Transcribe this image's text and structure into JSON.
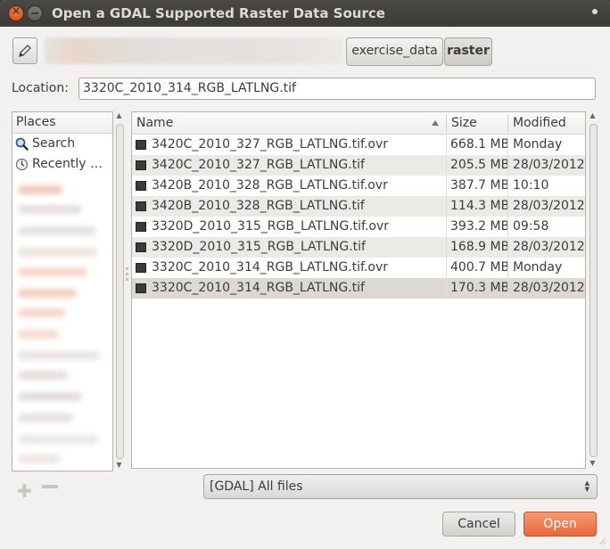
{
  "window": {
    "title": "Open a GDAL Supported Raster Data Source"
  },
  "path_bar": {
    "crumbs": [
      "exercise_data",
      "raster"
    ],
    "active_crumb": "raster"
  },
  "location": {
    "label": "Location:",
    "value": "3320C_2010_314_RGB_LATLNG.tif"
  },
  "places": {
    "header": "Places",
    "items": [
      {
        "label": "Search",
        "icon": "search-icon"
      },
      {
        "label": "Recently …",
        "icon": "recent-clock-icon"
      }
    ]
  },
  "files": {
    "columns": {
      "name": "Name",
      "size": "Size",
      "modified": "Modified"
    },
    "sort": "name-ascending",
    "rows": [
      {
        "name": "3420C_2010_327_RGB_LATLNG.tif.ovr",
        "size": "668.1 MB",
        "modified": "Monday"
      },
      {
        "name": "3420C_2010_327_RGB_LATLNG.tif",
        "size": "205.5 MB",
        "modified": "28/03/2012"
      },
      {
        "name": "3420B_2010_328_RGB_LATLNG.tif.ovr",
        "size": "387.7 MB",
        "modified": "10:10"
      },
      {
        "name": "3420B_2010_328_RGB_LATLNG.tif",
        "size": "114.3 MB",
        "modified": "28/03/2012"
      },
      {
        "name": "3320D_2010_315_RGB_LATLNG.tif.ovr",
        "size": "393.2 MB",
        "modified": "09:58"
      },
      {
        "name": "3320D_2010_315_RGB_LATLNG.tif",
        "size": "168.9 MB",
        "modified": "28/03/2012"
      },
      {
        "name": "3320C_2010_314_RGB_LATLNG.tif.ovr",
        "size": "400.7 MB",
        "modified": "Monday"
      },
      {
        "name": "3320C_2010_314_RGB_LATLNG.tif",
        "size": "170.3 MB",
        "modified": "28/03/2012"
      }
    ]
  },
  "filter": {
    "selected": "[GDAL] All files"
  },
  "buttons": {
    "cancel": "Cancel",
    "open": "Open"
  },
  "colors": {
    "titlebar": "#3c3b37",
    "accent": "#e9683c",
    "background": "#f2f1f0"
  }
}
